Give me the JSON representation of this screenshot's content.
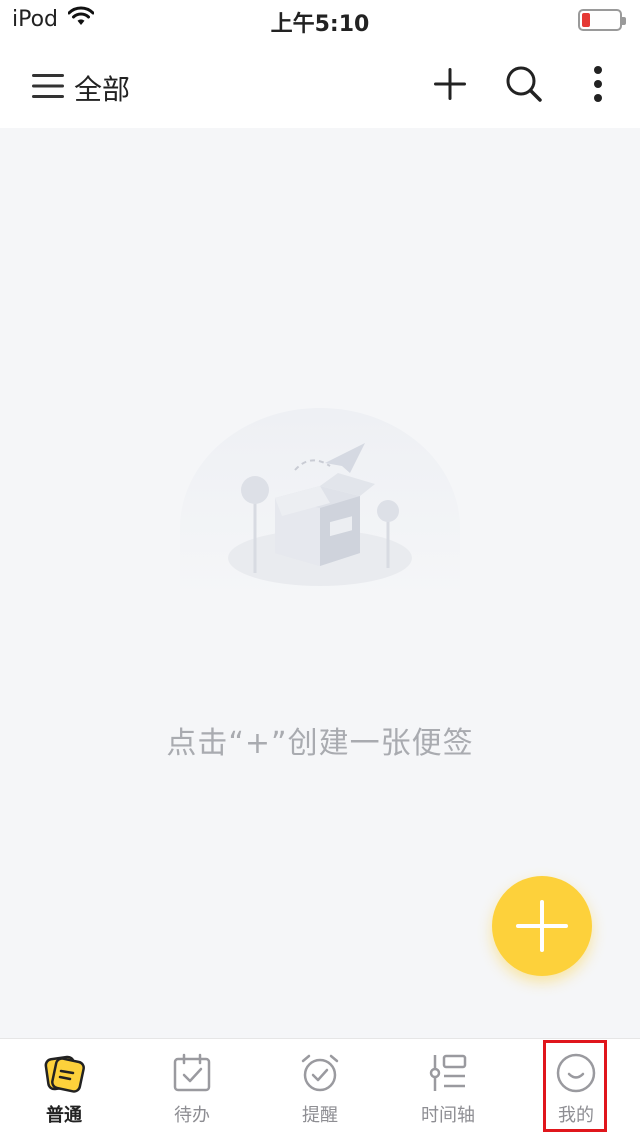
{
  "status_bar": {
    "carrier": "iPod",
    "time": "上午5:10"
  },
  "header": {
    "title": "全部"
  },
  "empty_state": {
    "message": "点击“+”创建一张便签"
  },
  "tabs": [
    {
      "label": "普通",
      "icon": "note-icon",
      "active": true
    },
    {
      "label": "待办",
      "icon": "calendar-check-icon",
      "active": false
    },
    {
      "label": "提醒",
      "icon": "alarm-clock-icon",
      "active": false
    },
    {
      "label": "时间轴",
      "icon": "timeline-icon",
      "active": false
    },
    {
      "label": "我的",
      "icon": "smiley-icon",
      "active": false
    }
  ],
  "colors": {
    "accent": "#fdd13b",
    "highlight": "#e0161c",
    "battery_low": "#e53935"
  }
}
